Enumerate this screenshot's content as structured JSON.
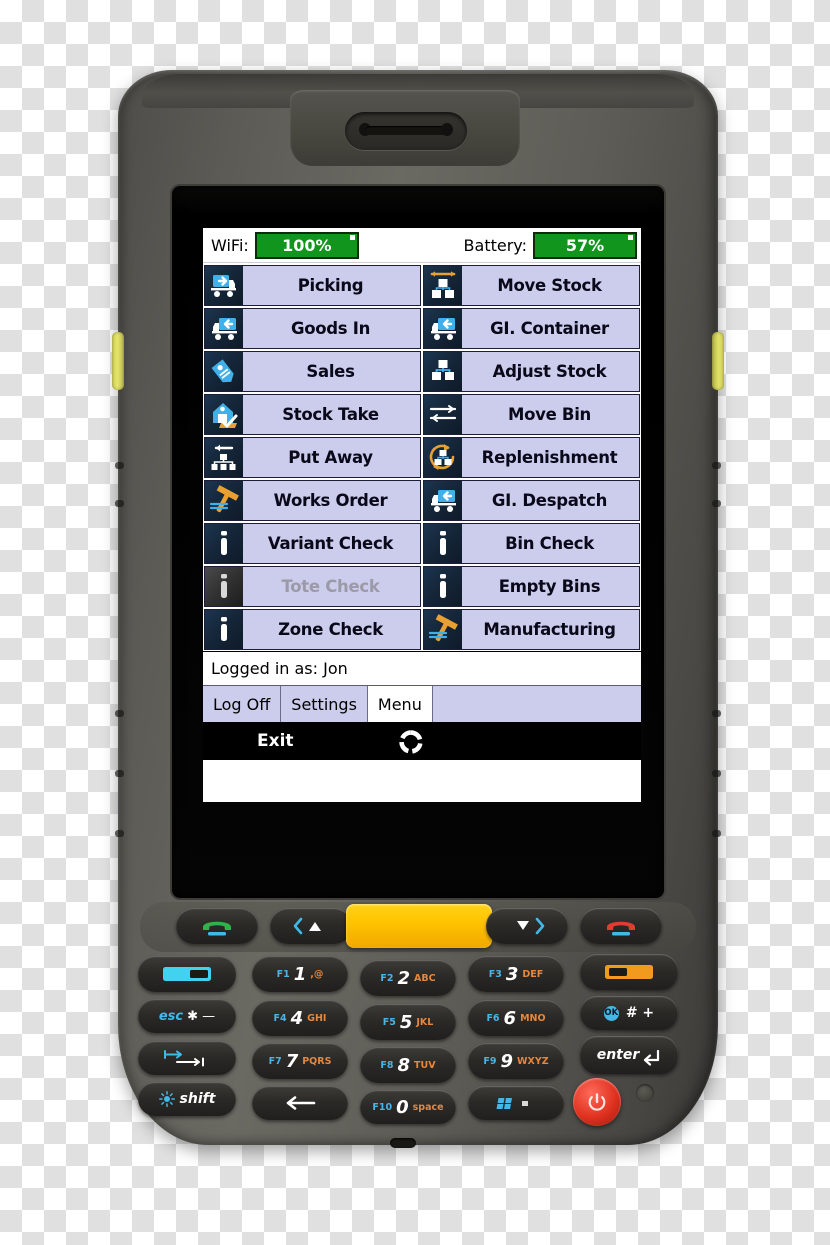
{
  "device": {
    "type": "rugged-handheld-barcode-terminal",
    "icons": {
      "scanner_window": "barcode-scanner-window-icon",
      "side_scan_button": "side-scan-button"
    }
  },
  "screen": {
    "status_bar": {
      "wifi_label": "WiFi:",
      "wifi_value": "100%",
      "battery_label": "Battery:",
      "battery_value": "57%",
      "chip_color": "#11951d"
    },
    "menu": {
      "items": [
        {
          "label": "Picking",
          "icon": "truck-out-icon",
          "enabled": true,
          "col": "left"
        },
        {
          "label": "Move Stock",
          "icon": "move-stock-icon",
          "enabled": true,
          "col": "right"
        },
        {
          "label": "Goods In",
          "icon": "truck-in-icon",
          "enabled": true,
          "col": "left"
        },
        {
          "label": "GI. Container",
          "icon": "truck-in-icon",
          "enabled": true,
          "col": "right"
        },
        {
          "label": "Sales",
          "icon": "price-tag-icon",
          "enabled": true,
          "col": "left"
        },
        {
          "label": "Adjust Stock",
          "icon": "boxes-icon",
          "enabled": true,
          "col": "right"
        },
        {
          "label": "Stock Take",
          "icon": "warehouse-check-icon",
          "enabled": true,
          "col": "left"
        },
        {
          "label": "Move Bin",
          "icon": "sliders-icon",
          "enabled": true,
          "col": "right"
        },
        {
          "label": "Put Away",
          "icon": "put-away-icon",
          "enabled": true,
          "col": "left"
        },
        {
          "label": "Replenishment",
          "icon": "replenish-cycle-icon",
          "enabled": true,
          "col": "right"
        },
        {
          "label": "Works Order",
          "icon": "hammer-icon",
          "enabled": true,
          "col": "left"
        },
        {
          "label": "GI. Despatch",
          "icon": "truck-in-icon",
          "enabled": true,
          "col": "right"
        },
        {
          "label": "Variant Check",
          "icon": "info-icon",
          "enabled": true,
          "col": "left"
        },
        {
          "label": "Bin Check",
          "icon": "info-icon",
          "enabled": true,
          "col": "right"
        },
        {
          "label": "Tote Check",
          "icon": "info-icon",
          "enabled": false,
          "col": "left"
        },
        {
          "label": "Empty Bins",
          "icon": "info-icon",
          "enabled": true,
          "col": "right"
        },
        {
          "label": "Zone Check",
          "icon": "info-icon",
          "enabled": true,
          "col": "left"
        },
        {
          "label": "Manufacturing",
          "icon": "hammer-icon",
          "enabled": true,
          "col": "right"
        }
      ],
      "button_color": "#ccccec",
      "disabled_text_color": "#9a9aa8"
    },
    "login_status": "Logged in as: Jon",
    "tabs": [
      {
        "label": "Log Off",
        "active": false
      },
      {
        "label": "Settings",
        "active": false
      },
      {
        "label": "Menu",
        "active": true
      }
    ],
    "taskbar": {
      "exit_label": "Exit",
      "spinner_icon": "activity-spinner-icon"
    }
  },
  "keypad": {
    "nav_row": [
      {
        "id": "call-key",
        "icon": "green-phone-icon"
      },
      {
        "id": "left-up-key",
        "icon": "left-up-nav-icon"
      },
      {
        "id": "scan-key",
        "icon": "yellow-scan-key"
      },
      {
        "id": "right-down-key",
        "icon": "right-down-nav-icon"
      },
      {
        "id": "end-key",
        "icon": "red-phone-icon"
      }
    ],
    "keys": [
      {
        "id": "softkey-left",
        "fn": "",
        "num": "",
        "alpha": "",
        "icon": "left-softkey-icon"
      },
      {
        "id": "key-1",
        "fn": "F1",
        "num": "1",
        "alpha": ",@"
      },
      {
        "id": "key-2",
        "fn": "F2",
        "num": "2",
        "alpha": "ABC"
      },
      {
        "id": "key-3",
        "fn": "F3",
        "num": "3",
        "alpha": "DEF"
      },
      {
        "id": "softkey-right",
        "fn": "",
        "num": "",
        "alpha": "",
        "icon": "right-softkey-icon"
      },
      {
        "id": "esc-key",
        "label": "esc",
        "symbols": "✱ —"
      },
      {
        "id": "key-4",
        "fn": "F4",
        "num": "4",
        "alpha": "GHI"
      },
      {
        "id": "key-5",
        "fn": "F5",
        "num": "5",
        "alpha": "JKL"
      },
      {
        "id": "key-6",
        "fn": "F6",
        "num": "6",
        "alpha": "MNO"
      },
      {
        "id": "ok-key",
        "label": "OK",
        "symbols": "# +"
      },
      {
        "id": "tab-key",
        "icon": "tab-arrows-icon"
      },
      {
        "id": "key-7",
        "fn": "F7",
        "num": "7",
        "alpha": "PQRS"
      },
      {
        "id": "key-8",
        "fn": "F8",
        "num": "8",
        "alpha": "TUV"
      },
      {
        "id": "key-9",
        "fn": "F9",
        "num": "9",
        "alpha": "WXYZ"
      },
      {
        "id": "enter-key",
        "label": "enter"
      },
      {
        "id": "shift-key",
        "label": "shift",
        "icon": "brightness-icon"
      },
      {
        "id": "backspace-key",
        "icon": "backspace-arrow-icon"
      },
      {
        "id": "key-0",
        "fn": "F10",
        "num": "0",
        "alpha": "space"
      },
      {
        "id": "start-key",
        "icon": "windows-start-icon"
      },
      {
        "id": "power-key",
        "icon": "power-icon"
      }
    ],
    "colors": {
      "fn_label": "#49b4e8",
      "alpha_label": "#e8863a",
      "scan_key": "#ffc400",
      "power_key": "#e0311f"
    }
  }
}
